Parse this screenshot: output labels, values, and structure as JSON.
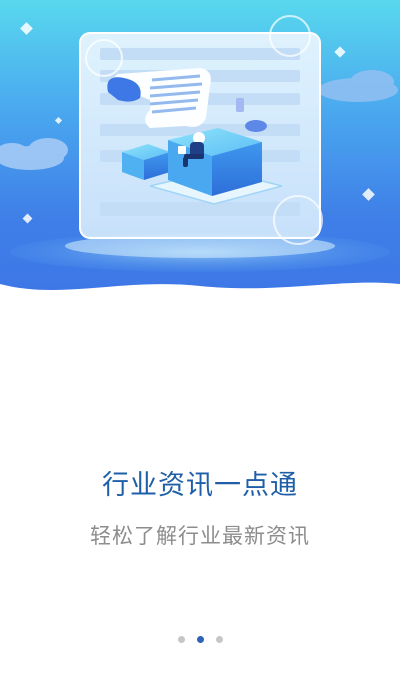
{
  "onboarding": {
    "headline": "行业资讯一点通",
    "subheadline": "轻松了解行业最新资讯",
    "pager": {
      "total": 3,
      "active_index": 1
    },
    "colors": {
      "headline": "#1f5fa8",
      "subheadline": "#8d8d8d",
      "dot_active": "#2d63b8",
      "dot_inactive": "#c6c6c6",
      "hero_top": "#58d8ee",
      "hero_bottom": "#3d76e6"
    }
  }
}
